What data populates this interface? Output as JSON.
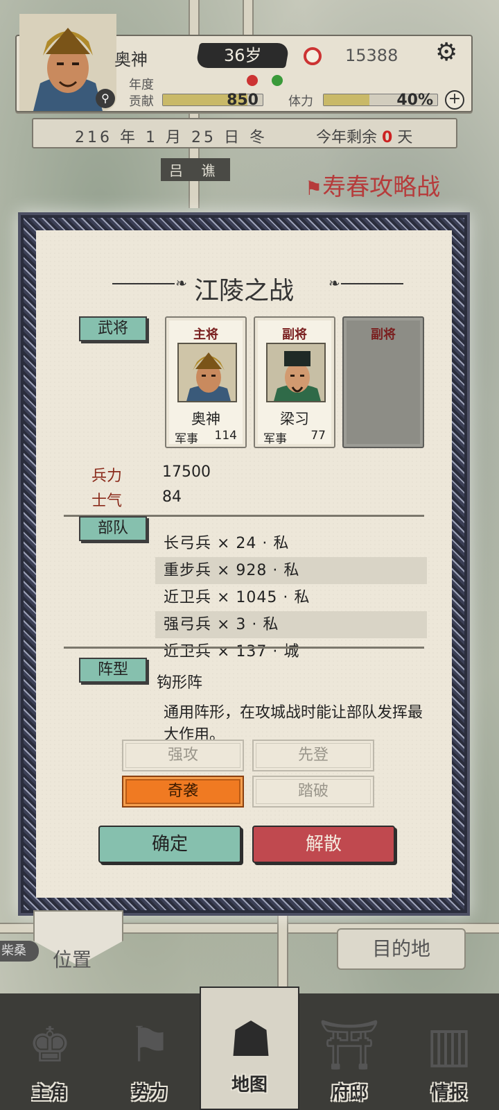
{
  "header": {
    "hero_name": "奥神",
    "age": "36岁",
    "coins": "15388",
    "contribution_label_top": "年度",
    "contribution_label": "贡献",
    "contribution_value": "850",
    "contribution_fill": 0.85,
    "stamina_label": "体力",
    "stamina_value": "40%",
    "stamina_fill": 0.4
  },
  "date_bar": {
    "date": "216 年 1 月 25 日 冬",
    "remain_prefix": "今年剩余",
    "remain_days": "0",
    "remain_suffix": "天"
  },
  "map": {
    "top_label": "吕 谯",
    "battle_banner": "寿春攻略战",
    "position_label": "位置",
    "position_city": "柴桑",
    "destination_button": "目的地"
  },
  "dialog": {
    "title": "江陵之战",
    "generals_tag": "武将",
    "generals": [
      {
        "role": "主将",
        "name": "奥神",
        "stat_label": "军事",
        "stat_value": "114"
      },
      {
        "role": "副将",
        "name": "梁习",
        "stat_label": "军事",
        "stat_value": "77"
      },
      {
        "role": "副将",
        "name": "",
        "stat_label": "",
        "stat_value": ""
      }
    ],
    "troops_label": "兵力",
    "troops_value": "17500",
    "morale_label": "士气",
    "morale_value": "84",
    "units_tag": "部队",
    "units": [
      "长弓兵 × 24 · 私",
      "重步兵 × 928 · 私",
      "近卫兵 × 1045 · 私",
      "强弓兵 × 3 · 私",
      "近卫兵 × 137 · 城"
    ],
    "formation_tag": "阵型",
    "formation_name": "钩形阵",
    "formation_desc": "通用阵形，在攻城战时能让部队发挥最大作用。",
    "tactics": [
      {
        "label": "强攻",
        "active": false
      },
      {
        "label": "先登",
        "active": false
      },
      {
        "label": "奇袭",
        "active": true
      },
      {
        "label": "踏破",
        "active": false
      }
    ],
    "confirm_button": "确定",
    "disband_button": "解散"
  },
  "nav": [
    {
      "label": "主角",
      "icon": "helmet-icon"
    },
    {
      "label": "势力",
      "icon": "flag-icon"
    },
    {
      "label": "地图",
      "icon": "map-icon"
    },
    {
      "label": "府邸",
      "icon": "mansion-icon"
    },
    {
      "label": "情报",
      "icon": "scroll-icon"
    }
  ],
  "colors": {
    "teal_tag": "#86c0ae",
    "confirm": "#86c0ae",
    "disband": "#c0494f",
    "active_tactic": "#f07a22",
    "accent_red": "#b63b3b"
  }
}
